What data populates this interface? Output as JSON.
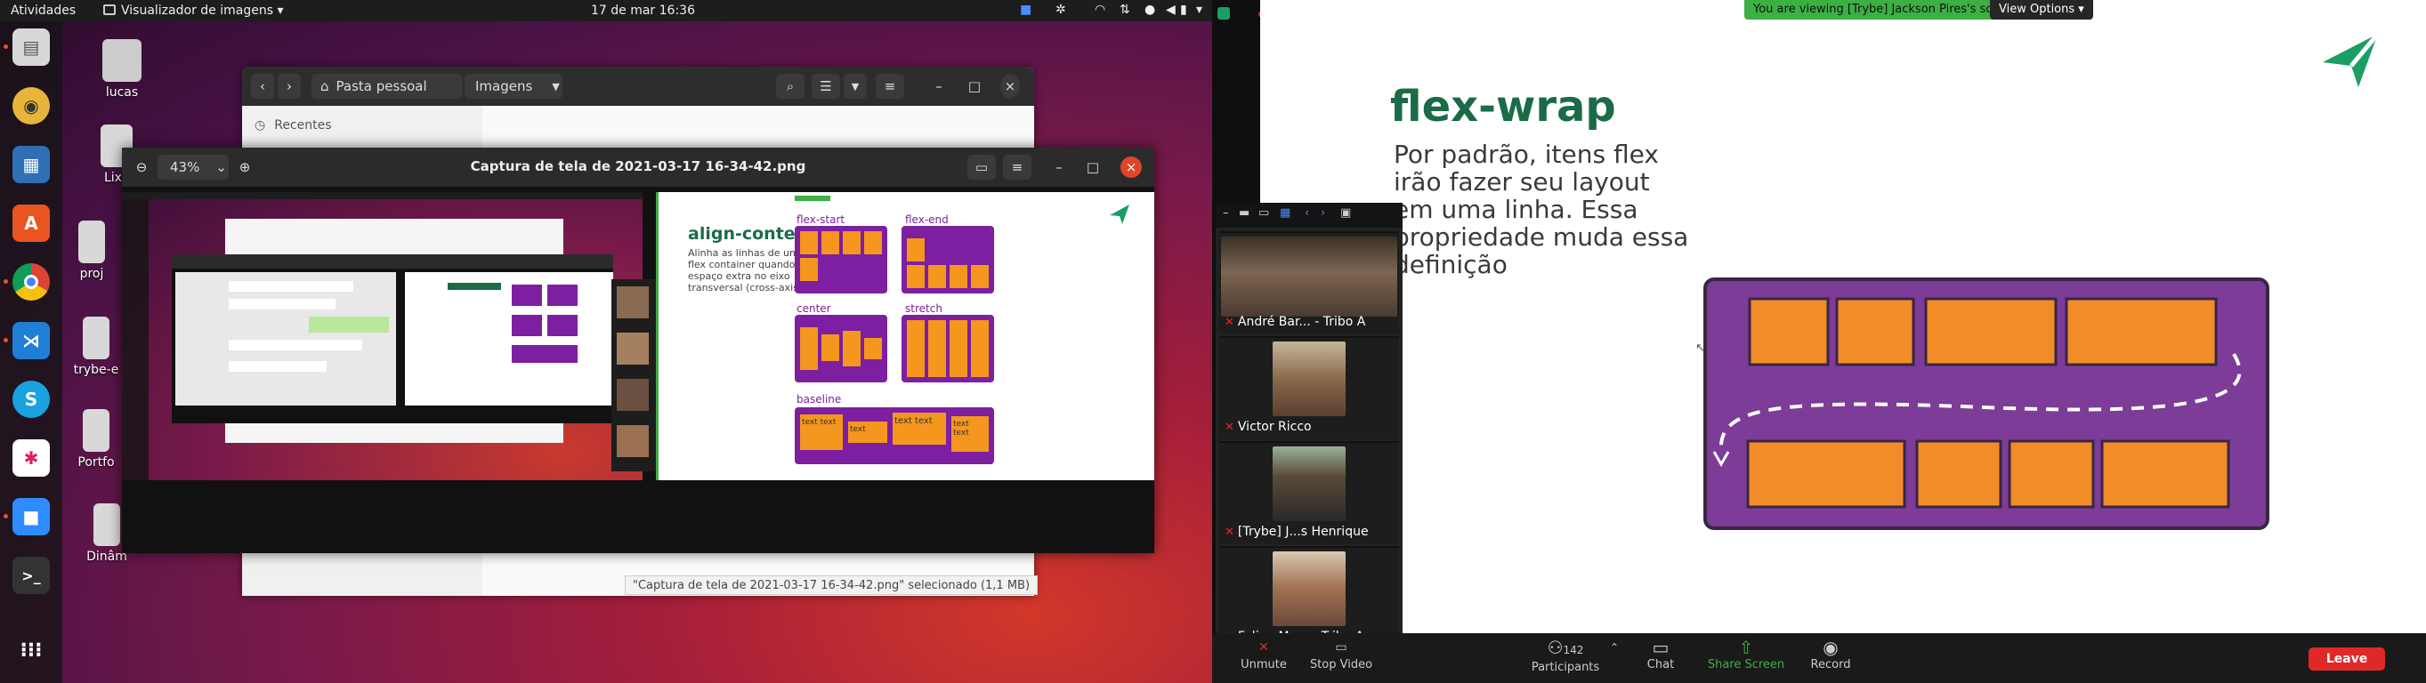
{
  "topbar": {
    "activities": "Atividades",
    "app_menu": "Visualizador de imagens",
    "clock": "17 de mar  16:36"
  },
  "desktop_icons": [
    {
      "label": "lucas"
    },
    {
      "label": "Lixo"
    },
    {
      "label": "proj"
    },
    {
      "label": "trybe-e"
    },
    {
      "label": "Portfo"
    },
    {
      "label": "Dinâm"
    }
  ],
  "files": {
    "breadcrumb_home": "Pasta pessoal",
    "breadcrumb_current": "Imagens",
    "sidebar_recent": "Recentes",
    "status": "\"Captura de tela de 2021-03-17 16-34-42.png\" selecionado (1,1 MB)"
  },
  "viewer": {
    "zoom": "43%",
    "title": "Captura de tela de 2021-03-17 16-34-42.png"
  },
  "inner_slide": {
    "title": "align-content",
    "text": "Alinha as linhas de um flex container quando há espaço extra no eixo transversal (cross-axis)",
    "labels": [
      "flex-start",
      "flex-end",
      "center",
      "stretch",
      "baseline"
    ],
    "baseline_items": [
      "text text",
      "text",
      "text text",
      "text text"
    ]
  },
  "zoom": {
    "banner": "You are viewing [Trybe] Jackson Pires's screen",
    "view_options": "View Options",
    "slide_title": "flex-wrap",
    "slide_text": "Por padrão, itens flex irão fazer seu layout em uma linha. Essa propriedade muda essa definição",
    "participants": [
      {
        "name": "André Bar... - Tribo A"
      },
      {
        "name": "Victor Ricco"
      },
      {
        "name": "[Trybe] J...s Henrique"
      },
      {
        "name": "Felipe Mu... - Tribo A"
      }
    ],
    "toolbar": {
      "unmute": "Unmute",
      "stop_video": "Stop Video",
      "participants": "Participants",
      "participants_count": "142",
      "chat": "Chat",
      "share_screen": "Share Screen",
      "record": "Record",
      "leave": "Leave"
    },
    "colors": {
      "accent_green": "#1a6b46",
      "share_green": "#3cb043",
      "leave_red": "#e02828"
    }
  }
}
